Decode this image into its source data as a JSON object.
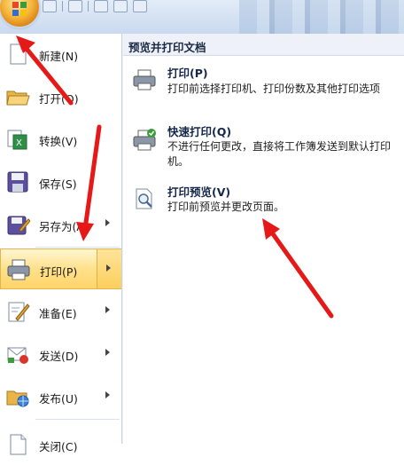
{
  "menu": {
    "items": [
      {
        "name": "new",
        "label": "新建(N)",
        "icon": "new-document-icon"
      },
      {
        "name": "open",
        "label": "打开(O)",
        "icon": "open-folder-icon"
      },
      {
        "name": "convert",
        "label": "转换(V)",
        "icon": "convert-icon"
      },
      {
        "name": "save",
        "label": "保存(S)",
        "icon": "save-disk-icon"
      },
      {
        "name": "save-as",
        "label": "另存为(A)",
        "icon": "save-as-icon",
        "submenu": true
      },
      {
        "name": "print",
        "label": "打印(P)",
        "icon": "printer-icon",
        "submenu": true,
        "selected": true
      },
      {
        "name": "prepare",
        "label": "准备(E)",
        "icon": "prepare-icon",
        "submenu": true
      },
      {
        "name": "send",
        "label": "发送(D)",
        "icon": "send-icon",
        "submenu": true
      },
      {
        "name": "publish",
        "label": "发布(U)",
        "icon": "publish-icon",
        "submenu": true
      },
      {
        "name": "close",
        "label": "关闭(C)",
        "icon": "close-document-icon"
      }
    ]
  },
  "print_pane": {
    "header": "预览并打印文档",
    "options": [
      {
        "title": "打印(P)",
        "desc": "打印前选择打印机、打印份数及其他打印选项",
        "icon": "printer-icon"
      },
      {
        "title": "快速打印(Q)",
        "desc": "不进行任何更改，直接将工作簿发送到默认打印机。",
        "icon": "quick-print-icon"
      },
      {
        "title": "打印预览(V)",
        "desc": "打印前预览并更改页面。",
        "icon": "print-preview-icon"
      }
    ]
  },
  "colors": {
    "selection": "#ffd46a",
    "annotation_arrow": "#e61919",
    "office_orb": "#f6b53a"
  }
}
